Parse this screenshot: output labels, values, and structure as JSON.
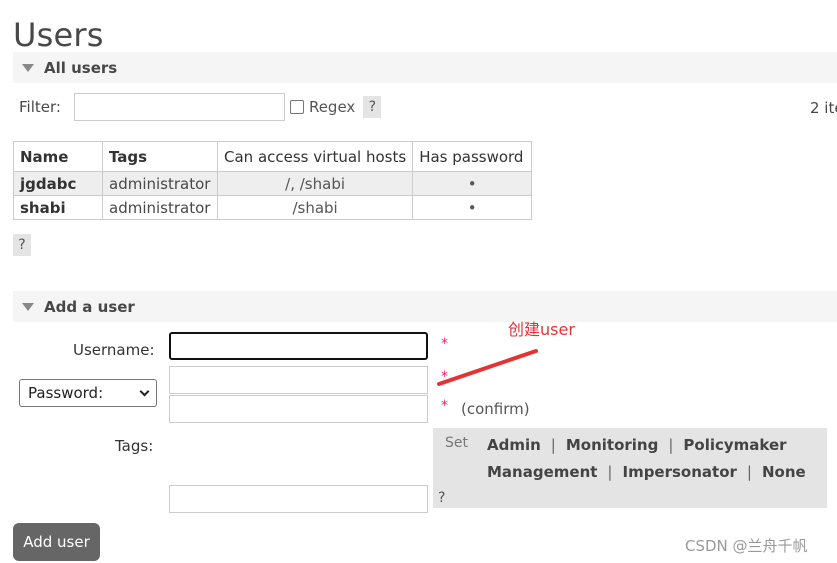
{
  "page_title": "Users",
  "all_users_section": {
    "title": "All users",
    "filter_label": "Filter:",
    "filter_value": "",
    "regex_label": "Regex",
    "help": "?",
    "items_count": "2 ite"
  },
  "table": {
    "headers": [
      "Name",
      "Tags",
      "Can access virtual hosts",
      "Has password"
    ],
    "rows": [
      {
        "name": "jgdabc",
        "tags": "administrator",
        "vhosts": "/, /shabi",
        "has_password": "•"
      },
      {
        "name": "shabi",
        "tags": "administrator",
        "vhosts": "/shabi",
        "has_password": "•"
      }
    ]
  },
  "table_help": "?",
  "add_user_section": {
    "title": "Add a user",
    "username_label": "Username:",
    "username_value": "",
    "required_star": "*",
    "password_select": "Password:",
    "confirm_label": "(confirm)",
    "tags_label": "Tags:",
    "set_label": "Set",
    "tag_options_line1": [
      "Admin",
      "Monitoring",
      "Policymaker"
    ],
    "tag_options_line2": [
      "Management",
      "Impersonator",
      "None"
    ],
    "tags_help": "?",
    "add_button": "Add user"
  },
  "annotation": {
    "text": "创建user",
    "color": "#e53333"
  },
  "watermark": "CSDN @兰舟千帆"
}
